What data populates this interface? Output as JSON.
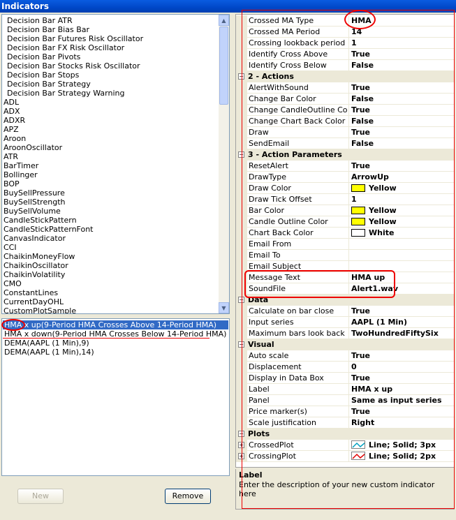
{
  "window": {
    "title": "Indicators"
  },
  "indicator_list": [
    "Decision Bar ATR",
    "Decision Bar Bias Bar",
    "Decision Bar Futures Risk Oscillator",
    "Decision Bar FX Risk Oscillator",
    "Decision Bar Pivots",
    "Decision Bar Stocks Risk Oscillator",
    "Decision Bar Stops",
    "Decision Bar Strategy",
    "Decision Bar Strategy Warning",
    "ADL",
    "ADX",
    "ADXR",
    "APZ",
    "Aroon",
    "AroonOscillator",
    "ATR",
    "BarTimer",
    "Bollinger",
    "BOP",
    "BuySellPressure",
    "BuySellStrength",
    "BuySellVolume",
    "CandleStickPattern",
    "CandleStickPatternFont",
    "CanvasIndicator",
    "CCI",
    "ChaikinMoneyFlow",
    "ChaikinOscillator",
    "ChaikinVolatility",
    "CMO",
    "ConstantLines",
    "CurrentDayOHL",
    "CustomPlotSample"
  ],
  "applied": [
    "HMA x up(9-Period HMA Crosses Above  14-Period HMA)",
    "HMA x down(9-Period HMA  Crosses Below 14-Period HMA)",
    "DEMA(AAPL (1 Min),9)",
    "DEMA(AAPL (1 Min),14)"
  ],
  "buttons": {
    "new": "New",
    "remove": "Remove"
  },
  "grid": {
    "top_rows": [
      {
        "name": "Crossed MA Type",
        "value": "HMA"
      },
      {
        "name": "Crossed MA Period",
        "value": "14"
      },
      {
        "name": "Crossing lookback period",
        "value": "1"
      },
      {
        "name": "Identify Cross Above",
        "value": "True"
      },
      {
        "name": "Identify Cross Below",
        "value": "False"
      }
    ],
    "cat_actions": "2 - Actions",
    "actions": [
      {
        "name": "AlertWithSound",
        "value": "True"
      },
      {
        "name": "Change Bar Color",
        "value": "False"
      },
      {
        "name": "Change CandleOutline Color",
        "value": "True"
      },
      {
        "name": "Change Chart Back Color",
        "value": "False"
      },
      {
        "name": "Draw",
        "value": "True"
      },
      {
        "name": "SendEmail",
        "value": "False"
      }
    ],
    "cat_params": "3 - Action Parameters",
    "params": [
      {
        "name": "ResetAlert",
        "value": "True"
      },
      {
        "name": "DrawType",
        "value": "ArrowUp"
      },
      {
        "name": "Draw Color",
        "value": "Yellow",
        "swatch": "#ffff00"
      },
      {
        "name": "Draw Tick Offset",
        "value": "1"
      },
      {
        "name": "Bar Color",
        "value": "Yellow",
        "swatch": "#ffff00"
      },
      {
        "name": "Candle Outline Color",
        "value": "Yellow",
        "swatch": "#ffff00"
      },
      {
        "name": "Chart Back Color",
        "value": "White",
        "swatch": "#ffffff"
      },
      {
        "name": "Email From",
        "value": ""
      },
      {
        "name": "Email To",
        "value": ""
      },
      {
        "name": "Email Subject",
        "value": ""
      },
      {
        "name": "Message Text",
        "value": "HMA up"
      },
      {
        "name": "SoundFile",
        "value": "Alert1.wav"
      }
    ],
    "cat_data": "Data",
    "data": [
      {
        "name": "Calculate on bar close",
        "value": "True"
      },
      {
        "name": "Input series",
        "value": "AAPL (1 Min)"
      },
      {
        "name": "Maximum bars look back",
        "value": "TwoHundredFiftySix"
      }
    ],
    "cat_visual": "Visual",
    "visual": [
      {
        "name": "Auto scale",
        "value": "True"
      },
      {
        "name": "Displacement",
        "value": "0"
      },
      {
        "name": "Display in Data Box",
        "value": "True"
      },
      {
        "name": "Label",
        "value": "HMA x up"
      },
      {
        "name": "Panel",
        "value": "Same as input series"
      },
      {
        "name": "Price marker(s)",
        "value": "True"
      },
      {
        "name": "Scale justification",
        "value": "Right"
      }
    ],
    "cat_plots": "Plots",
    "plots": [
      {
        "name": "CrossedPlot",
        "value": "Line; Solid; 3px",
        "color": "#00a0c0"
      },
      {
        "name": "CrossingPlot",
        "value": "Line; Solid; 2px",
        "color": "#e00000"
      }
    ]
  },
  "description": {
    "title": "Label",
    "text": "Enter the description of your new custom indicator here"
  }
}
